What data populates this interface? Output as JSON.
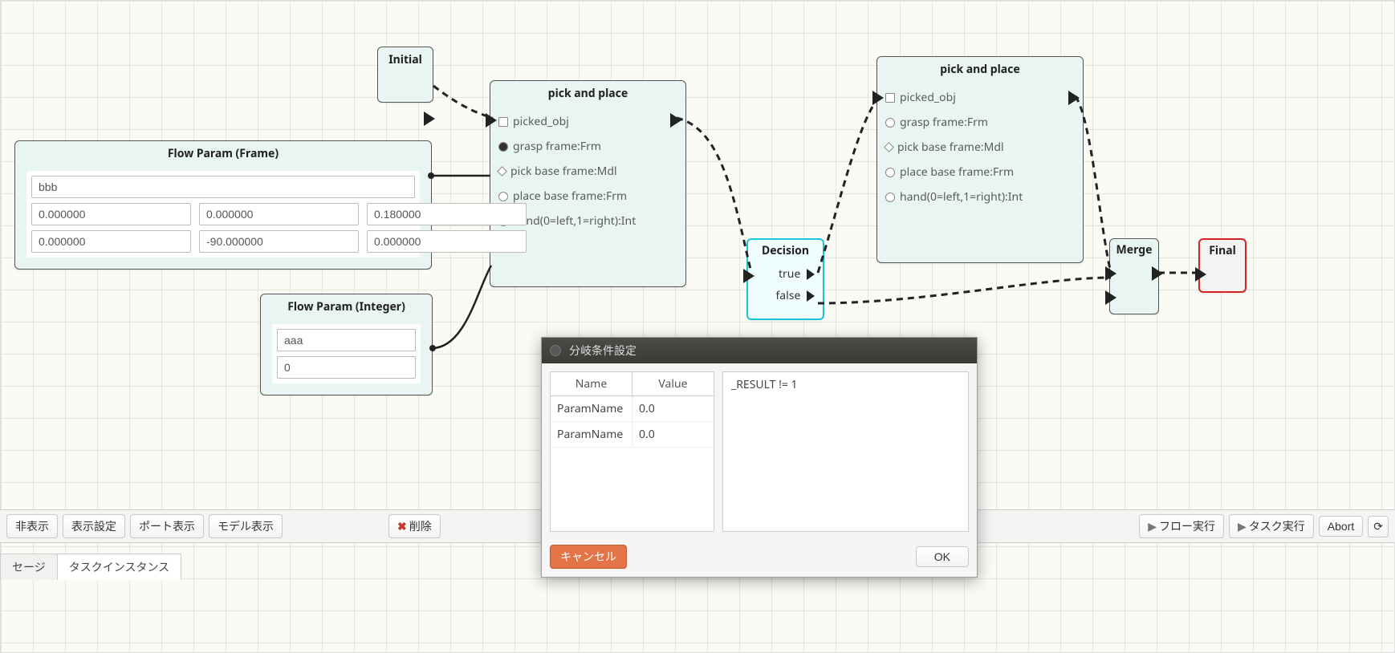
{
  "nodes": {
    "initial": {
      "title": "Initial"
    },
    "pick1": {
      "title": "pick and place",
      "ports": [
        {
          "shape": "square",
          "filled": false,
          "label": "picked_obj"
        },
        {
          "shape": "circle",
          "filled": true,
          "label": "grasp frame:Frm"
        },
        {
          "shape": "diamond",
          "filled": false,
          "label": "pick base frame:Mdl"
        },
        {
          "shape": "circle",
          "filled": false,
          "label": "place base frame:Frm"
        },
        {
          "shape": "circle",
          "filled": true,
          "label": "hand(0=left,1=right):Int"
        }
      ]
    },
    "pick2": {
      "title": "pick and place",
      "ports": [
        {
          "shape": "square",
          "filled": false,
          "label": "picked_obj"
        },
        {
          "shape": "circle",
          "filled": false,
          "label": "grasp frame:Frm"
        },
        {
          "shape": "diamond",
          "filled": false,
          "label": "pick base frame:Mdl"
        },
        {
          "shape": "circle",
          "filled": false,
          "label": "place base frame:Frm"
        },
        {
          "shape": "circle",
          "filled": false,
          "label": "hand(0=left,1=right):Int"
        }
      ]
    },
    "frameparam": {
      "title": "Flow Param (Frame)",
      "name_value": "bbb",
      "row1": [
        "0.000000",
        "0.000000",
        "0.180000"
      ],
      "row2": [
        "0.000000",
        "-90.000000",
        "0.000000"
      ]
    },
    "intparam": {
      "title": "Flow Param (Integer)",
      "name_value": "aaa",
      "value": "0"
    },
    "decision": {
      "title": "Decision",
      "true_label": "true",
      "false_label": "false"
    },
    "merge": {
      "title": "Merge"
    },
    "final": {
      "title": "Final"
    }
  },
  "toolbar": {
    "hide": "非表示",
    "display_settings": "表示設定",
    "port_display": "ポート表示",
    "model_display": "モデル表示",
    "delete": "削除",
    "flow_run": "フロー実行",
    "task_run": "タスク実行",
    "abort": "Abort"
  },
  "tabs": {
    "left": "セージ",
    "active": "タスクインスタンス"
  },
  "dialog": {
    "title": "分岐条件設定",
    "col_name": "Name",
    "col_value": "Value",
    "rows": [
      {
        "name": "ParamName",
        "value": "0.0"
      },
      {
        "name": "ParamName",
        "value": "0.0"
      }
    ],
    "expr": "_RESULT != 1",
    "cancel": "キャンセル",
    "ok": "OK"
  }
}
